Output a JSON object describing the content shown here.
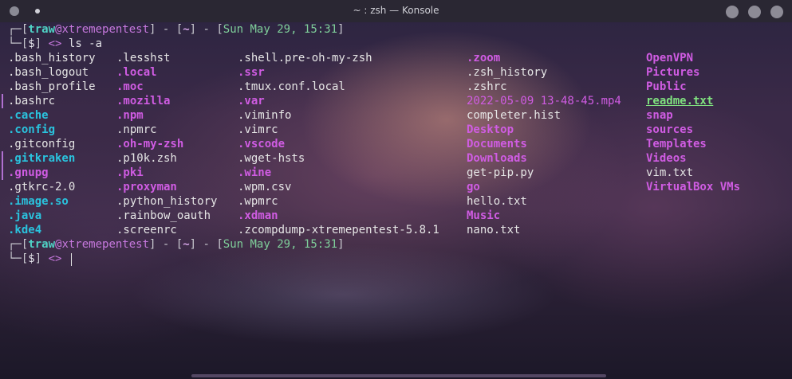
{
  "window": {
    "title": "~ : zsh — Konsole"
  },
  "prompt": {
    "open_bracket": "┌─[",
    "user": "traw",
    "at": "@",
    "host": "xtremepentest",
    "sep1": "] - [",
    "dir": "~",
    "sep2": "] - [",
    "date": "Sun May 29, 15:31",
    "close": "]",
    "line2_prefix": "└─[",
    "dollar": "$",
    "line2_close": "] ",
    "arrow": "<>"
  },
  "command": "ls -a",
  "listing": {
    "columns": [
      [
        {
          "name": ".bash_history",
          "type": "file"
        },
        {
          "name": ".bash_logout",
          "type": "file"
        },
        {
          "name": ".bash_profile",
          "type": "file"
        },
        {
          "name": ".bashrc",
          "type": "file"
        },
        {
          "name": ".cache",
          "type": "cyan"
        },
        {
          "name": ".config",
          "type": "cyan"
        },
        {
          "name": ".gitconfig",
          "type": "file"
        },
        {
          "name": ".gitkraken",
          "type": "cyan"
        },
        {
          "name": ".gnupg",
          "type": "dir"
        },
        {
          "name": ".gtkrc-2.0",
          "type": "file"
        },
        {
          "name": ".image.so",
          "type": "cyan"
        },
        {
          "name": ".java",
          "type": "cyan"
        },
        {
          "name": ".kde4",
          "type": "cyan"
        }
      ],
      [
        {
          "name": ".lesshst",
          "type": "file"
        },
        {
          "name": ".local",
          "type": "dir"
        },
        {
          "name": ".moc",
          "type": "dir"
        },
        {
          "name": ".mozilla",
          "type": "dir"
        },
        {
          "name": ".npm",
          "type": "dir"
        },
        {
          "name": ".npmrc",
          "type": "file"
        },
        {
          "name": ".oh-my-zsh",
          "type": "dir"
        },
        {
          "name": ".p10k.zsh",
          "type": "file"
        },
        {
          "name": ".pki",
          "type": "dir"
        },
        {
          "name": ".proxyman",
          "type": "dir"
        },
        {
          "name": ".python_history",
          "type": "file"
        },
        {
          "name": ".rainbow_oauth",
          "type": "file"
        },
        {
          "name": ".screenrc",
          "type": "file"
        }
      ],
      [
        {
          "name": ".shell.pre-oh-my-zsh",
          "type": "file"
        },
        {
          "name": ".ssr",
          "type": "dir"
        },
        {
          "name": ".tmux.conf.local",
          "type": "file"
        },
        {
          "name": ".var",
          "type": "dir"
        },
        {
          "name": ".viminfo",
          "type": "file"
        },
        {
          "name": ".vimrc",
          "type": "file"
        },
        {
          "name": ".vscode",
          "type": "dir"
        },
        {
          "name": ".wget-hsts",
          "type": "file"
        },
        {
          "name": ".wine",
          "type": "dir"
        },
        {
          "name": ".wpm.csv",
          "type": "file"
        },
        {
          "name": ".wpmrc",
          "type": "file"
        },
        {
          "name": ".xdman",
          "type": "dir"
        },
        {
          "name": ".zcompdump-xtremepentest-5.8.1",
          "type": "file"
        }
      ],
      [
        {
          "name": ".zoom",
          "type": "dir"
        },
        {
          "name": ".zsh_history",
          "type": "file"
        },
        {
          "name": ".zshrc",
          "type": "file"
        },
        {
          "name": "2022-05-09 13-48-45.mp4",
          "type": "media"
        },
        {
          "name": "completer.hist",
          "type": "file"
        },
        {
          "name": "Desktop",
          "type": "dir"
        },
        {
          "name": "Documents",
          "type": "dir"
        },
        {
          "name": "Downloads",
          "type": "dir"
        },
        {
          "name": "get-pip.py",
          "type": "file"
        },
        {
          "name": "go",
          "type": "dir"
        },
        {
          "name": "hello.txt",
          "type": "file"
        },
        {
          "name": "Music",
          "type": "dir"
        },
        {
          "name": "nano.txt",
          "type": "file"
        }
      ],
      [
        {
          "name": "OpenVPN",
          "type": "dir"
        },
        {
          "name": "Pictures",
          "type": "dir"
        },
        {
          "name": "Public",
          "type": "dir"
        },
        {
          "name": "readme.txt",
          "type": "link"
        },
        {
          "name": "snap",
          "type": "dir"
        },
        {
          "name": "sources",
          "type": "dir"
        },
        {
          "name": "Templates",
          "type": "dir"
        },
        {
          "name": "Videos",
          "type": "dir"
        },
        {
          "name": "vim.txt",
          "type": "file"
        },
        {
          "name": "VirtualBox VMs",
          "type": "dir"
        }
      ]
    ]
  }
}
